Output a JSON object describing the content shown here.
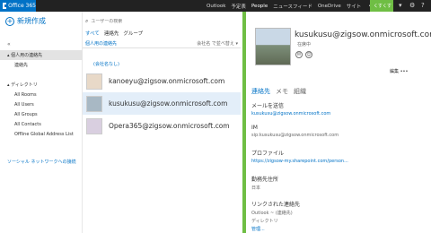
{
  "topbar": {
    "brand": "Office 365",
    "nav": [
      "Outlook",
      "予定表",
      "People",
      "ニュースフィード",
      "OneDrive",
      "サイト"
    ],
    "more": "•••",
    "user": "くすくす",
    "icons": [
      "user-dropdown-icon",
      "gear-icon",
      "help-icon"
    ]
  },
  "left": {
    "new_contact": "新規作成",
    "collapse": "«",
    "tree": [
      {
        "label": "▴ 個人用の連絡先",
        "selected": true
      },
      {
        "label": "連絡先",
        "indent": true
      },
      {
        "label": "▴ ディレクトリ"
      },
      {
        "label": "All Rooms",
        "indent": true
      },
      {
        "label": "All Users",
        "indent": true
      },
      {
        "label": "All Groups",
        "indent": true
      },
      {
        "label": "All Contacts",
        "indent": true
      },
      {
        "label": "Offline Global Address List",
        "indent": true
      }
    ],
    "social": "ソーシャル ネットワークへの接続"
  },
  "middle": {
    "search_placeholder": "ユーザーの検索",
    "filters": [
      "すべて",
      "連絡先",
      "グループ"
    ],
    "list_title": "個人用の連絡先",
    "sort": "会社名 で並べ替え ▾",
    "group_header": "(会社名なし)",
    "contacts": [
      {
        "name": "kanoeyu@zigsow.onmicrosoft.com"
      },
      {
        "name": "kusukusu@zigsow.onmicrosoft.com",
        "selected": true
      },
      {
        "name": "Opera365@zigsow.onmicrosoft.com"
      }
    ]
  },
  "detail": {
    "name": "kusukusu@zigsow.onmicrosoft.com",
    "status": "在席中",
    "edit": "編集 •••",
    "tabs": [
      "連絡先",
      "メモ",
      "組織"
    ],
    "fields": [
      {
        "label": "メールを送信",
        "value": "kusukusu@zigsow.onmicrosoft.com",
        "link": true
      },
      {
        "label": "IM",
        "value": "sip:kusukusu@zigsow.onmicrosoft.com",
        "link": false
      },
      {
        "label": "プロファイル",
        "value": "https://zigsow-my.sharepoint.com/person...",
        "link": true
      },
      {
        "label": "勤務先住所",
        "value": "日本",
        "link": false
      },
      {
        "label": "リンクされた連絡先",
        "value": "Outlook ~ (連絡先)",
        "extra": "ディレクトリ",
        "link": false
      }
    ],
    "manage": "管理..."
  },
  "colors": {
    "accent": "#0072c6",
    "topbar": "#222222",
    "green": "#6fbe44"
  }
}
